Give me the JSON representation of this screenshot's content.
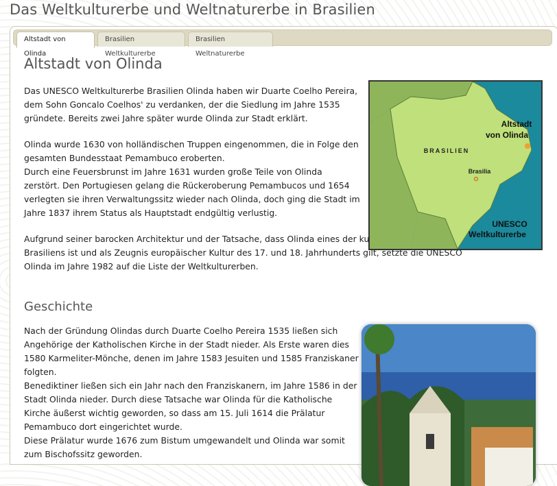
{
  "header": {
    "title": "Das Weltkulturerbe und Weltnaturerbe in Brasilien"
  },
  "tabs": [
    {
      "label": "Altstadt von Olinda",
      "active": true
    },
    {
      "label": "Brasilien Weltkulturerbe",
      "active": false
    },
    {
      "label": "Brasilien Weltnaturerbe",
      "active": false
    }
  ],
  "olinda": {
    "title": "Altstadt von Olinda",
    "para1": "Das UNESCO Weltkulturerbe Brasilien Olinda haben wir Duarte Coelho Pereira, dem Sohn Goncalo Coelhos' zu verdanken, der die Siedlung im Jahre 1535 gründete. Bereits zwei Jahre später wurde Olinda zur Stadt erklärt.",
    "para2a": "Olinda wurde 1630 von holländischen Truppen eingenommen, die in Folge den gesamten Bundesstaat Pemambuco eroberten.",
    "para2b": "Durch eine Feuersbrunst im Jahre 1631 wurden große Teile von Olinda zerstört. Den Portugiesen gelang die Rückeroberung Pemambucos und 1654 verlegten sie ihren Verwaltungssitz wieder nach Olinda, doch ging die Stadt im Jahre 1837 ihrem Status als Hauptstadt endgültig verlustig.",
    "para3": "Aufgrund seiner barocken Architektur und der Tatsache, dass Olinda eines der kulturellen Zentren Brasiliens ist und als Zeugnis europäischer Kultur des 17. und 18. Jahrhunderts gilt, setzte die UNESCO Olinda im Jahre 1982 auf die Liste der Weltkulturerben."
  },
  "map": {
    "label_altstadt_1": "Altstadt",
    "label_altstadt_2": "von Olinda",
    "label_country": "BRASILIEN",
    "label_capital": "Brasilia",
    "label_unesco_1": "UNESCO",
    "label_unesco_2": "Weltkulturerbe",
    "colors": {
      "sea": "#1b8a9c",
      "brazil": "#bfe07a",
      "neighbors": "#8fb55a",
      "marker": "#f0a030"
    }
  },
  "geschichte": {
    "title": "Geschichte",
    "p1": "Nach der Gründung Olindas durch Duarte Coelho Pereira 1535 ließen sich Angehörige der Katholischen Kirche in der Stadt nieder. Als Erste waren dies 1580 Karmeliter-Mönche, denen im Jahre 1583 Jesuiten und 1585 Franziskaner folgten.",
    "p2": "Benediktiner ließen sich ein Jahr nach den Franziskanern, im Jahre 1586 in der Stadt Olinda nieder. Durch diese Tatsache war Olinda für die Katholische Kirche äußerst wichtig geworden, so dass am 15. Juli 1614 die Prälatur Pemambuco dort eingerichtet wurde.",
    "p3": "Diese Prälatur wurde 1676 zum Bistum umgewandelt und Olinda war somit zum Bischofssitz geworden."
  }
}
